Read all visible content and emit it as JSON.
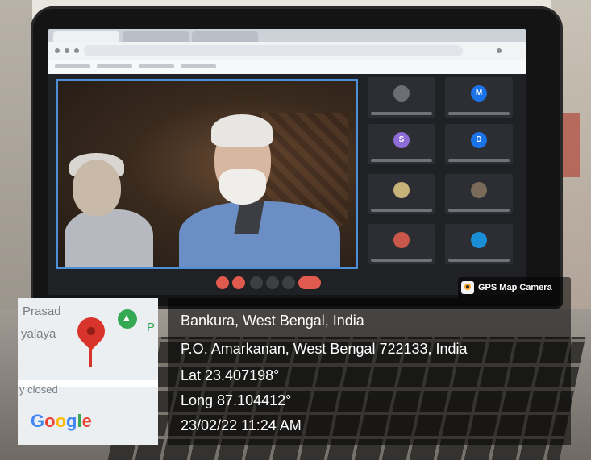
{
  "overlay": {
    "badge": "GPS Map Camera",
    "place": "Bankura, West Bengal, India",
    "address": "P.O. Amarkanan, West Bengal 722133, India",
    "latitude": "Lat 23.407198°",
    "longitude": "Long 87.104412°",
    "datetime": "23/02/22 11:24 AM"
  },
  "map": {
    "label_top": "Prasad",
    "label_mid": "yalaya",
    "label_right": "P",
    "label_status": "y closed",
    "brand": [
      "G",
      "o",
      "o",
      "g",
      "l",
      "e"
    ]
  },
  "colors": {
    "pin": "#d9342b",
    "google_blue": "#4285f4",
    "google_red": "#ea4335",
    "google_yellow": "#fbbc05",
    "google_green": "#34a853",
    "active_speaker_border": "#4c8fd6"
  },
  "participant_tiles": [
    {
      "initial": "",
      "color": "#6d6d74"
    },
    {
      "initial": "M",
      "color": "#1a73e8"
    },
    {
      "initial": "S",
      "color": "#8e6cd8"
    },
    {
      "initial": "D",
      "color": "#1a73e8"
    },
    {
      "initial": "",
      "color": "#c7b27a"
    },
    {
      "initial": "",
      "color": "#7a6a58"
    },
    {
      "initial": "",
      "color": "#c9574a"
    },
    {
      "initial": "",
      "color": "#1a8fd8"
    }
  ]
}
